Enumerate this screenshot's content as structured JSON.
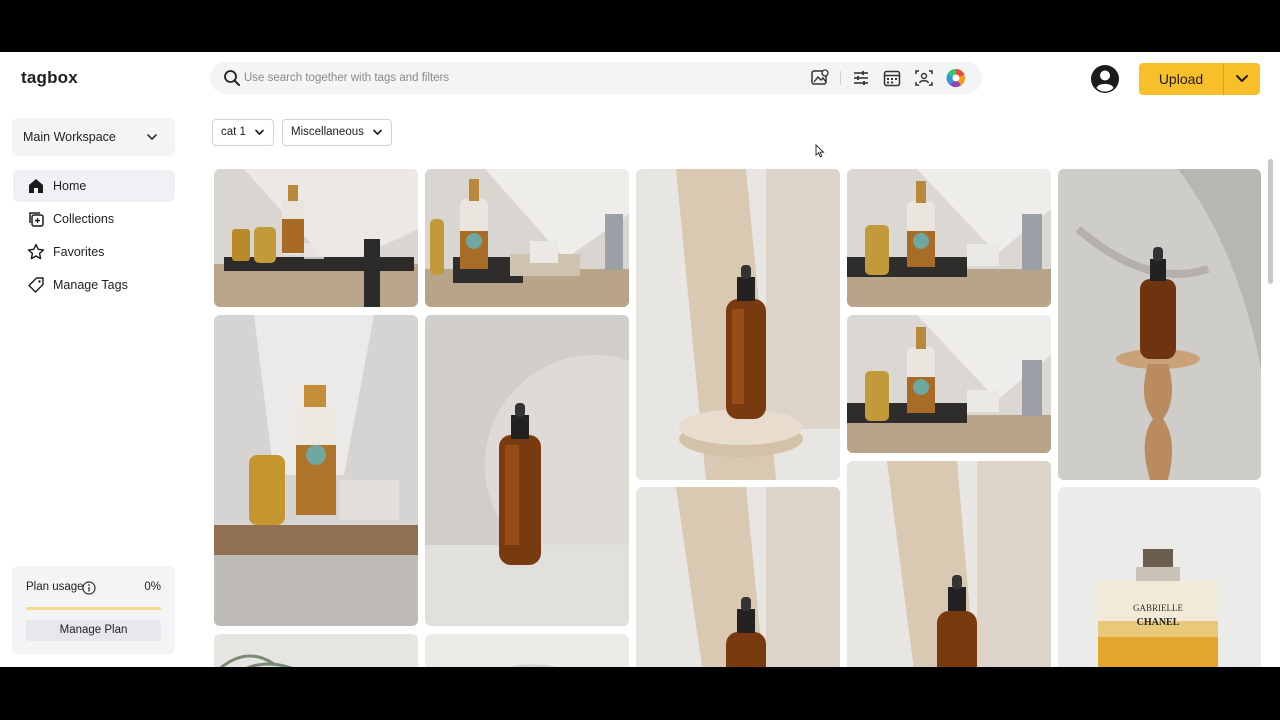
{
  "app": {
    "logo": "tagbox"
  },
  "search": {
    "placeholder": "Use search together with tags and filters",
    "tools": [
      "image-search-icon",
      "sliders-icon",
      "calendar-icon",
      "face-scan-icon",
      "color-wheel-icon"
    ]
  },
  "header": {
    "upload_label": "Upload"
  },
  "sidebar": {
    "workspace": "Main Workspace",
    "items": [
      {
        "label": "Home",
        "icon": "home-icon",
        "active": true
      },
      {
        "label": "Collections",
        "icon": "collections-icon",
        "active": false
      },
      {
        "label": "Favorites",
        "icon": "star-icon",
        "active": false
      },
      {
        "label": "Manage Tags",
        "icon": "tag-icon",
        "active": false
      }
    ],
    "plan": {
      "label": "Plan usage",
      "percent_text": "0%",
      "button": "Manage Plan"
    }
  },
  "filters": [
    {
      "label": "cat 1"
    },
    {
      "label": "Miscellaneous"
    }
  ],
  "gallery": {
    "columns": [
      [
        {
          "kind": "bar-cart"
        },
        {
          "kind": "bar-cart-close"
        },
        {
          "kind": "plant"
        }
      ],
      [
        {
          "kind": "bar-cart"
        },
        {
          "kind": "dropper-bottle"
        },
        {
          "kind": "plant"
        }
      ],
      [
        {
          "kind": "dropper-pedestal"
        },
        {
          "kind": "dropper-pedestal"
        }
      ],
      [
        {
          "kind": "bar-cart"
        },
        {
          "kind": "bar-cart"
        },
        {
          "kind": "dropper-pedestal"
        }
      ],
      [
        {
          "kind": "dropper-shadow"
        },
        {
          "kind": "perfume",
          "labels": [
            "GABRIELLE",
            "CHANEL"
          ]
        }
      ]
    ]
  },
  "colors": {
    "accent": "#f7bf2a",
    "sidebar_active": "#f0f1f4"
  }
}
